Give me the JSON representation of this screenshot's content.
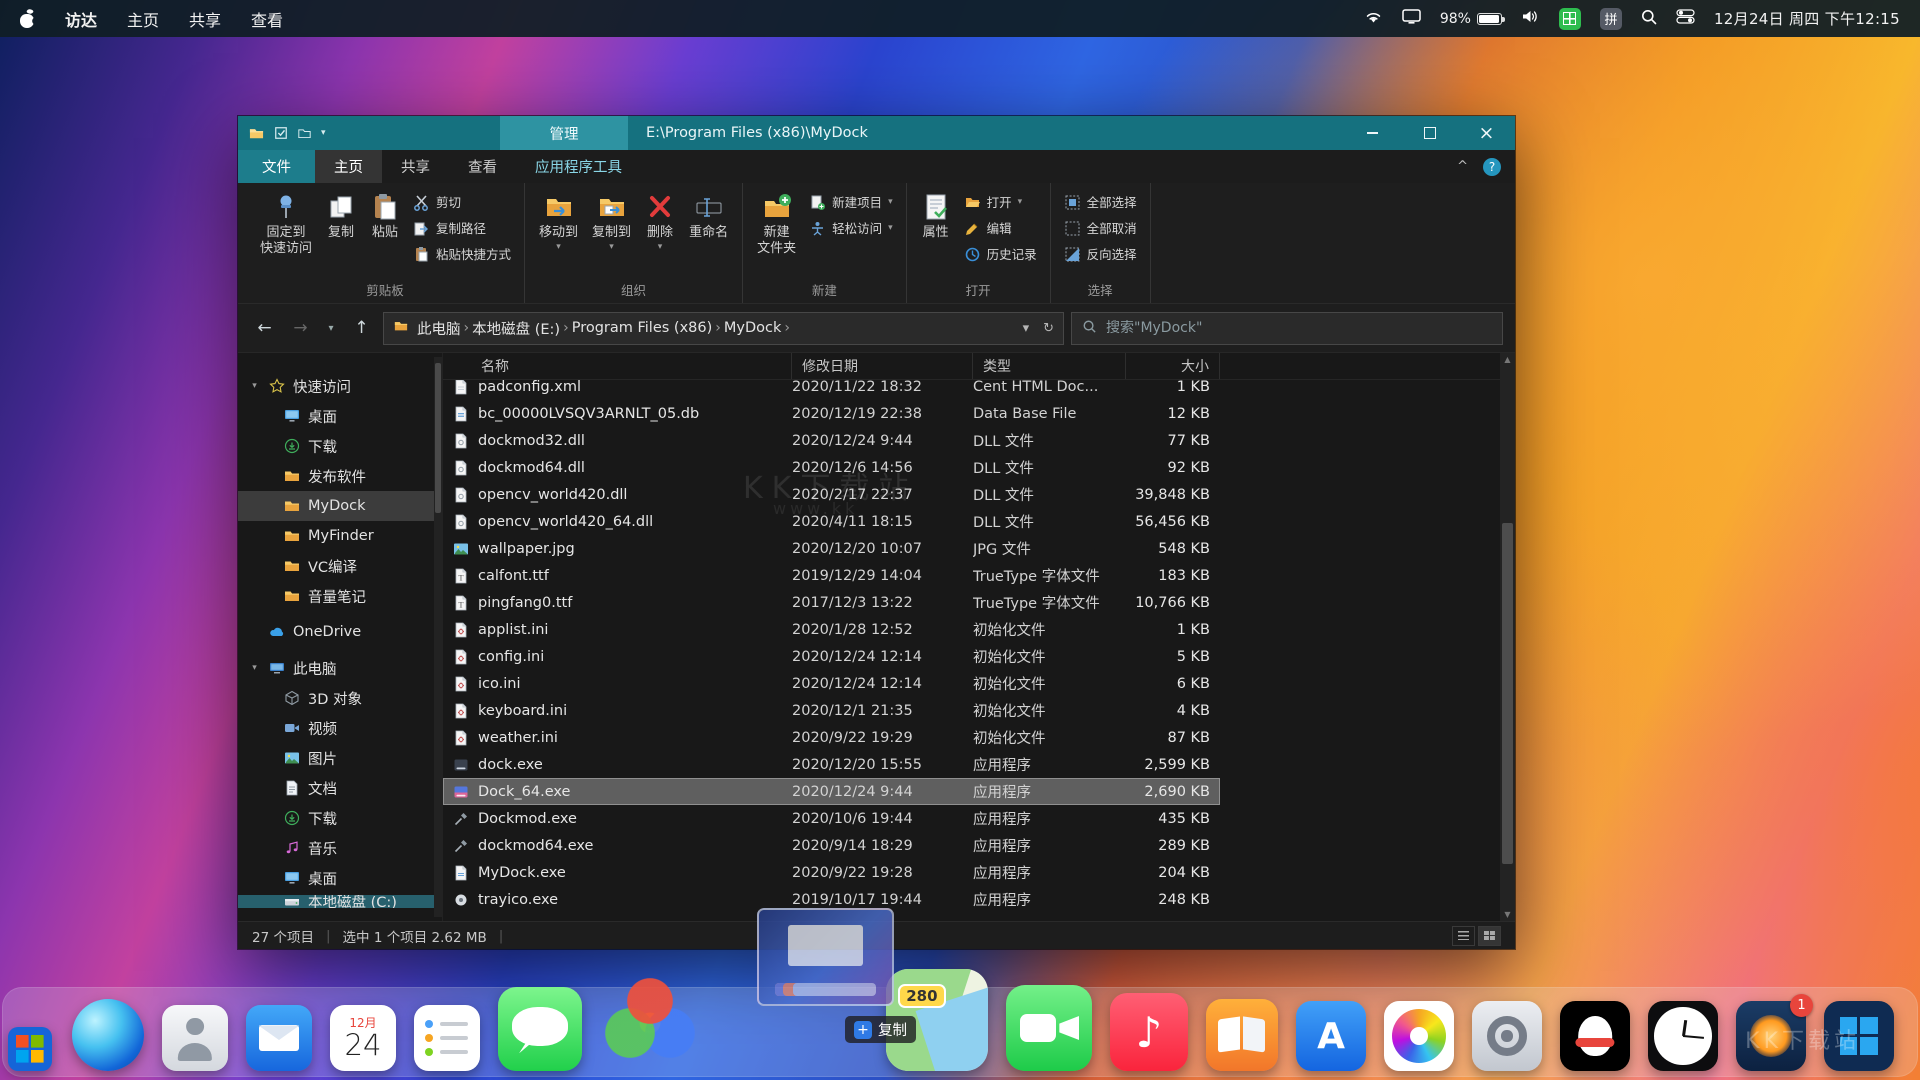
{
  "menubar": {
    "app_items": [
      "访达",
      "主页",
      "共享",
      "查看"
    ],
    "battery_percent": "98%",
    "ime_pinyin": "拼",
    "datetime": "12月24日 周四 下午12:15"
  },
  "explorer": {
    "titlebar": {
      "manage": "管理",
      "title": "E:\\Program Files (x86)\\MyDock"
    },
    "tabs": {
      "file": "文件",
      "items": [
        {
          "label": "主页",
          "selected": true
        },
        {
          "label": "共享"
        },
        {
          "label": "查看"
        },
        {
          "label": "应用程序工具",
          "accent": true
        }
      ]
    },
    "ribbon_groups": [
      {
        "label": "剪贴板",
        "buttons": [
          {
            "label": "固定到\n快速访问",
            "icon": "pin",
            "size": "large"
          },
          {
            "label": "复制",
            "icon": "copy",
            "size": "large"
          },
          {
            "label": "粘贴",
            "icon": "paste",
            "size": "large"
          },
          {
            "label": "剪切",
            "icon": "cut",
            "size": "small"
          },
          {
            "label": "复制路径",
            "icon": "copy-path",
            "size": "small"
          },
          {
            "label": "粘贴快捷方式",
            "icon": "paste-shortcut",
            "size": "small"
          }
        ]
      },
      {
        "label": "组织",
        "buttons": [
          {
            "label": "移动到",
            "icon": "move-to",
            "size": "large",
            "dropdown": true
          },
          {
            "label": "复制到",
            "icon": "copy-to",
            "size": "large",
            "dropdown": true
          },
          {
            "label": "删除",
            "icon": "delete",
            "size": "large",
            "dropdown": true
          },
          {
            "label": "重命名",
            "icon": "rename",
            "size": "large"
          }
        ]
      },
      {
        "label": "新建",
        "buttons": [
          {
            "label": "新建\n文件夹",
            "icon": "new-folder",
            "size": "large"
          },
          {
            "label": "新建项目",
            "icon": "new-item",
            "size": "small",
            "dropdown": true
          },
          {
            "label": "轻松访问",
            "icon": "easy-access",
            "size": "small",
            "dropdown": true
          }
        ]
      },
      {
        "label": "打开",
        "buttons": [
          {
            "label": "属性",
            "icon": "properties",
            "size": "large"
          },
          {
            "label": "打开",
            "icon": "open",
            "size": "small",
            "dropdown": true
          },
          {
            "label": "编辑",
            "icon": "edit",
            "size": "small"
          },
          {
            "label": "历史记录",
            "icon": "history",
            "size": "small"
          }
        ]
      },
      {
        "label": "选择",
        "buttons": [
          {
            "label": "全部选择",
            "icon": "select-all",
            "size": "small"
          },
          {
            "label": "全部取消",
            "icon": "select-none",
            "size": "small"
          },
          {
            "label": "反向选择",
            "icon": "invert-selection",
            "size": "small"
          }
        ]
      }
    ],
    "nav": {
      "breadcrumb": [
        "此电脑",
        "本地磁盘 (E:)",
        "Program Files (x86)",
        "MyDock"
      ],
      "search_placeholder": "搜索\"MyDock\""
    },
    "sidebar": {
      "sections": [
        {
          "label": "快速访问",
          "icon": "star",
          "chevron": true,
          "items": [
            {
              "label": "桌面",
              "icon": "desktop",
              "pin": true
            },
            {
              "label": "下载",
              "icon": "download",
              "pin": true
            },
            {
              "label": "发布软件",
              "icon": "folder",
              "pin": true
            },
            {
              "label": "MyDock",
              "icon": "folder",
              "pin": true,
              "selected": true
            },
            {
              "label": "MyFinder",
              "icon": "folder",
              "pin": true
            },
            {
              "label": "VC编译",
              "icon": "folder",
              "pin": true
            },
            {
              "label": "音量笔记",
              "icon": "folder",
              "pin": true
            }
          ]
        },
        {
          "label": "OneDrive",
          "icon": "cloud",
          "chevron": false,
          "items": []
        },
        {
          "label": "此电脑",
          "icon": "computer",
          "chevron": true,
          "items": [
            {
              "label": "3D 对象",
              "icon": "cube"
            },
            {
              "label": "视频",
              "icon": "video"
            },
            {
              "label": "图片",
              "icon": "picture"
            },
            {
              "label": "文档",
              "icon": "document"
            },
            {
              "label": "下载",
              "icon": "download"
            },
            {
              "label": "音乐",
              "icon": "music"
            },
            {
              "label": "桌面",
              "icon": "desktop"
            },
            {
              "label": "本地磁盘 (C:)",
              "icon": "disk",
              "partial": true
            }
          ]
        }
      ]
    },
    "columns": [
      {
        "label": "名称"
      },
      {
        "label": "修改日期"
      },
      {
        "label": "类型",
        "sorted": true
      },
      {
        "label": "大小"
      }
    ],
    "files": [
      {
        "name": "padconfig.xml",
        "date": "2020/11/22 18:32",
        "type": "Cent HTML Doc...",
        "size": "1 KB",
        "icon": "xml"
      },
      {
        "name": "bc_00000LVSQV3ARNLT_05.db",
        "date": "2020/12/19 22:38",
        "type": "Data Base File",
        "size": "12 KB",
        "icon": "db"
      },
      {
        "name": "dockmod32.dll",
        "date": "2020/12/24 9:44",
        "type": "DLL 文件",
        "size": "77 KB",
        "icon": "dll"
      },
      {
        "name": "dockmod64.dll",
        "date": "2020/12/6 14:56",
        "type": "DLL 文件",
        "size": "92 KB",
        "icon": "dll"
      },
      {
        "name": "opencv_world420.dll",
        "date": "2020/2/17 22:37",
        "type": "DLL 文件",
        "size": "39,848 KB",
        "icon": "dll"
      },
      {
        "name": "opencv_world420_64.dll",
        "date": "2020/4/11 18:15",
        "type": "DLL 文件",
        "size": "56,456 KB",
        "icon": "dll"
      },
      {
        "name": "wallpaper.jpg",
        "date": "2020/12/20 10:07",
        "type": "JPG 文件",
        "size": "548 KB",
        "icon": "jpg"
      },
      {
        "name": "calfont.ttf",
        "date": "2019/12/29 14:04",
        "type": "TrueType 字体文件",
        "size": "183 KB",
        "icon": "ttf"
      },
      {
        "name": "pingfang0.ttf",
        "date": "2017/12/3 13:22",
        "type": "TrueType 字体文件",
        "size": "10,766 KB",
        "icon": "ttf"
      },
      {
        "name": "applist.ini",
        "date": "2020/1/28 12:52",
        "type": "初始化文件",
        "size": "1 KB",
        "icon": "ini"
      },
      {
        "name": "config.ini",
        "date": "2020/12/24 12:14",
        "type": "初始化文件",
        "size": "5 KB",
        "icon": "ini"
      },
      {
        "name": "ico.ini",
        "date": "2020/12/24 12:14",
        "type": "初始化文件",
        "size": "6 KB",
        "icon": "ini"
      },
      {
        "name": "keyboard.ini",
        "date": "2020/12/1 21:35",
        "type": "初始化文件",
        "size": "4 KB",
        "icon": "ini"
      },
      {
        "name": "weather.ini",
        "date": "2020/9/22 19:29",
        "type": "初始化文件",
        "size": "87 KB",
        "icon": "ini"
      },
      {
        "name": "dock.exe",
        "date": "2020/12/20 15:55",
        "type": "应用程序",
        "size": "2,599 KB",
        "icon": "app-dark"
      },
      {
        "name": "Dock_64.exe",
        "date": "2020/12/24 9:44",
        "type": "应用程序",
        "size": "2,690 KB",
        "icon": "app-color",
        "selected": true
      },
      {
        "name": "Dockmod.exe",
        "date": "2020/10/6 19:44",
        "type": "应用程序",
        "size": "435 KB",
        "icon": "app-tool"
      },
      {
        "name": "dockmod64.exe",
        "date": "2020/9/14 18:29",
        "type": "应用程序",
        "size": "289 KB",
        "icon": "app-tool"
      },
      {
        "name": "MyDock.exe",
        "date": "2020/9/22 19:28",
        "type": "应用程序",
        "size": "204 KB",
        "icon": "app-page"
      },
      {
        "name": "trayico.exe",
        "date": "2019/10/17 19:44",
        "type": "应用程序",
        "size": "248 KB",
        "icon": "app-tray"
      }
    ],
    "status": {
      "count": "27 个项目",
      "selection": "选中 1 个项目 2.62 MB"
    }
  },
  "dock": {
    "items": [
      {
        "id": "launchpad"
      },
      {
        "id": "edge"
      },
      {
        "id": "contacts"
      },
      {
        "id": "mail"
      },
      {
        "id": "calendar",
        "month": "12月",
        "day": "24"
      },
      {
        "id": "reminders"
      },
      {
        "id": "messages"
      },
      {
        "id": "colorsync"
      },
      {
        "id": "drag-gap"
      },
      {
        "id": "maps",
        "badge": "280"
      },
      {
        "id": "facetime"
      },
      {
        "id": "music"
      },
      {
        "id": "books"
      },
      {
        "id": "appstore"
      },
      {
        "id": "photos"
      },
      {
        "id": "settings"
      },
      {
        "id": "qq"
      },
      {
        "id": "clock"
      },
      {
        "id": "weather",
        "notif": "1"
      },
      {
        "id": "windows"
      }
    ]
  },
  "drag": {
    "plus": "+",
    "label": "复制"
  },
  "watermarks": {
    "line1": "KK下载站",
    "line2": "www.kk",
    "dock": "KK下载站"
  }
}
